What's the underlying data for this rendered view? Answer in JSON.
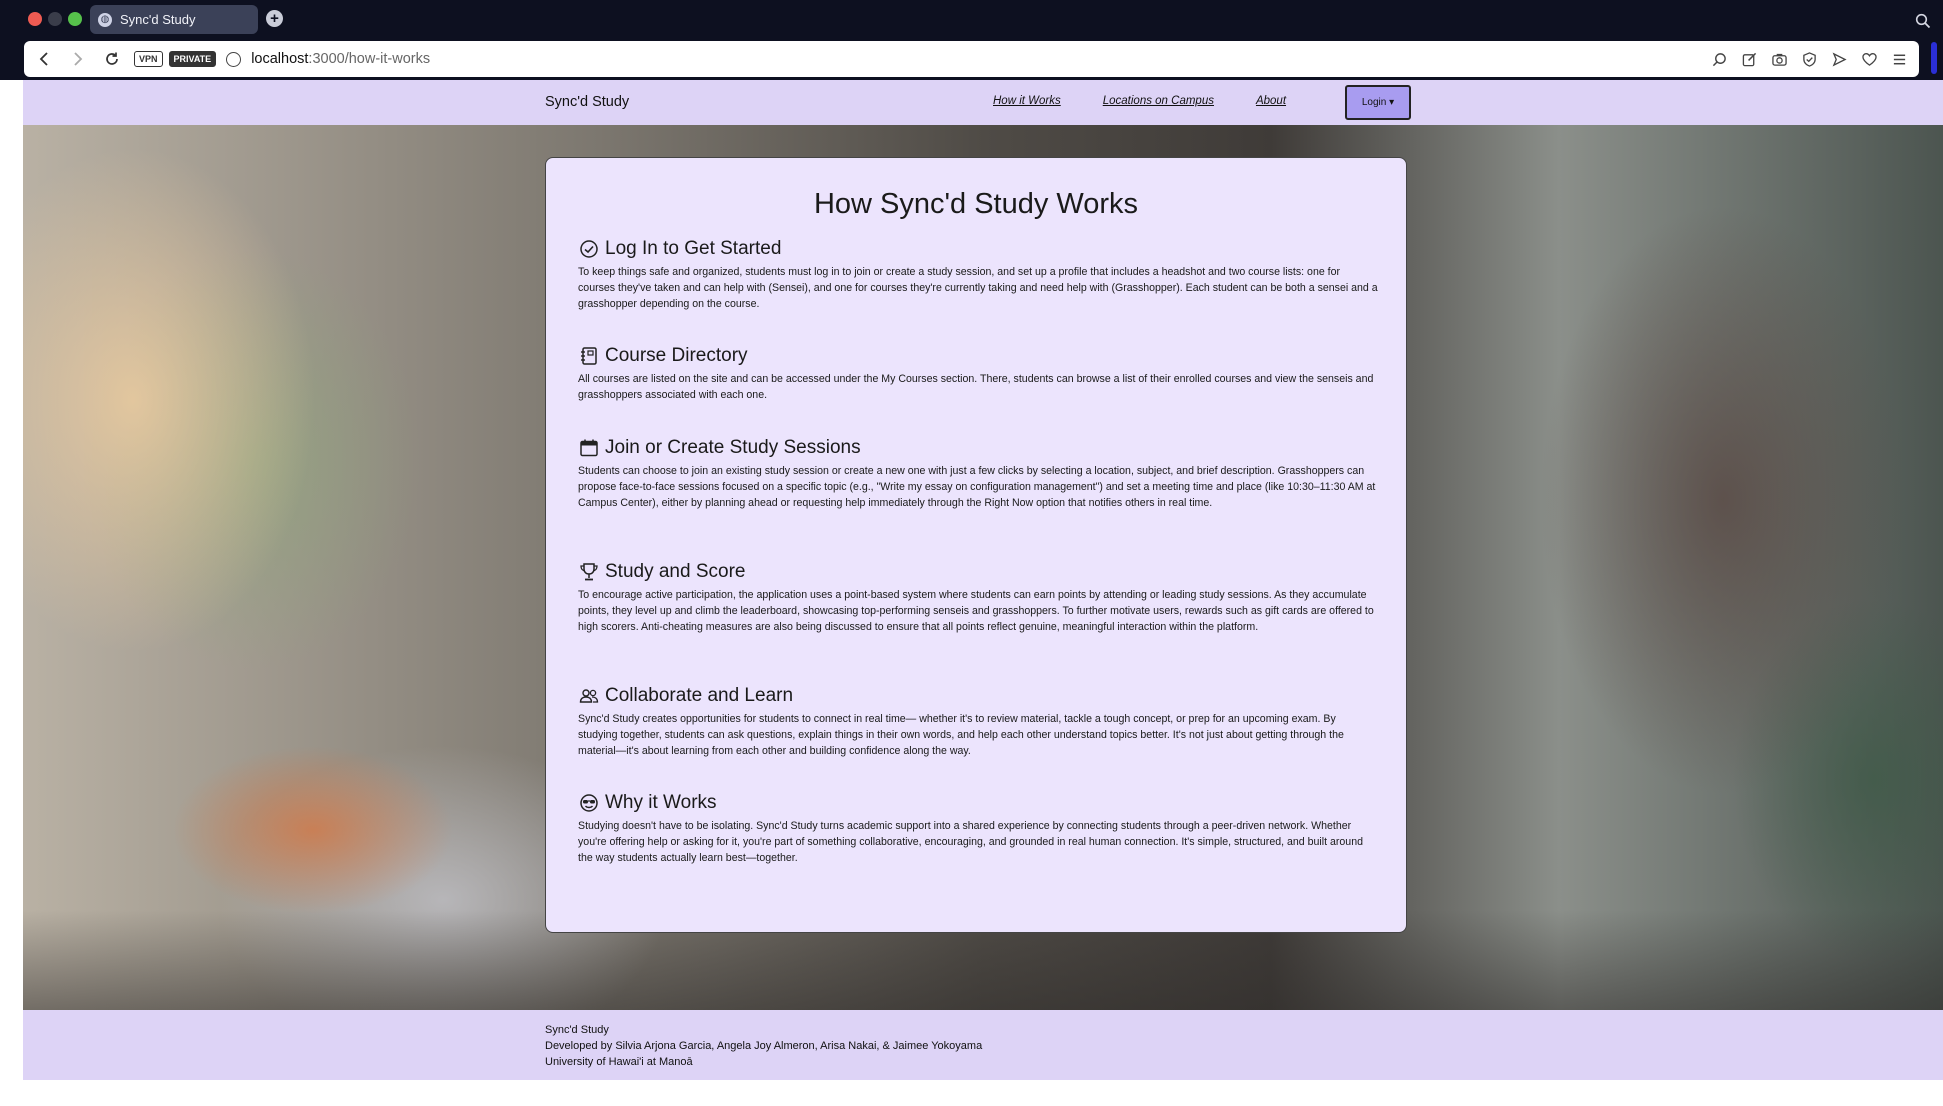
{
  "browser": {
    "tab_title": "Sync'd Study",
    "url_host": "localhost",
    "url_path": ":3000/how-it-works",
    "vpn_label": "VPN",
    "private_label": "PRIVATE"
  },
  "nav": {
    "brand": "Sync'd Study",
    "links": [
      "How it Works",
      "Locations on Campus",
      "About"
    ],
    "login_label": "Login ▾"
  },
  "main": {
    "title": "How Sync'd Study Works",
    "sections": [
      {
        "icon": "check-circle-icon",
        "title": "Log In to Get Started",
        "body": "To keep things safe and organized, students must log in to join or create a study session, and set up a profile that includes a headshot and two course lists: one for courses they've taken and can help with (Sensei), and one for courses they're currently taking and need help with (Grasshopper). Each student can be both a sensei and a grasshopper depending on the course."
      },
      {
        "icon": "journal-icon",
        "title": "Course Directory",
        "body": "All courses are listed on the site and can be accessed under the My Courses section. There, students can browse a list of their enrolled courses and view the senseis and grasshoppers associated with each one."
      },
      {
        "icon": "calendar-icon",
        "title": "Join or Create Study Sessions",
        "body": "Students can choose to join an existing study session or create a new one with just a few clicks by selecting a location, subject, and brief description. Grasshoppers can propose face-to-face sessions focused on a specific topic (e.g., \"Write my essay on configuration management\") and set a meeting time and place (like 10:30–11:30 AM at Campus Center), either by planning ahead or requesting help immediately through the Right Now option that notifies others in real time."
      },
      {
        "icon": "trophy-icon",
        "title": "Study and Score",
        "body": "To encourage active participation, the application uses a point-based system where students can earn points by attending or leading study sessions. As they accumulate points, they level up and climb the leaderboard, showcasing top-performing senseis and grasshoppers. To further motivate users, rewards such as gift cards are offered to high scorers. Anti-cheating measures are also being discussed to ensure that all points reflect genuine, meaningful interaction within the platform."
      },
      {
        "icon": "people-icon",
        "title": "Collaborate and Learn",
        "body": "Sync'd Study creates opportunities for students to connect in real time— whether it's to review material, tackle a tough concept, or prep for an upcoming exam. By studying together, students can ask questions, explain things in their own words, and help each other understand topics better. It's not just about getting through the material—it's about learning from each other and building confidence along the way."
      },
      {
        "icon": "sunglasses-emoji-icon",
        "title": "Why it Works",
        "body": "Studying doesn't have to be isolating. Sync'd Study turns academic support into a shared experience by connecting students through a peer-driven network. Whether you're offering help or asking for it, you're part of something collaborative, encouraging, and grounded in real human connection. It's simple, structured, and built around the way students actually learn best—together."
      }
    ]
  },
  "footer": {
    "line1": "Sync'd Study",
    "line2": "Developed by Silvia Arjona Garcia, Angela Joy Almeron, Arisa Nakai, & Jaimee Yokoyama",
    "line3": "University of Hawai'i at Manoā"
  },
  "colors": {
    "nav_bg": "#ddd3f6",
    "card_bg": "#ece4fd",
    "login_bg": "#a89cf0",
    "chrome_bg": "#0d1020"
  }
}
